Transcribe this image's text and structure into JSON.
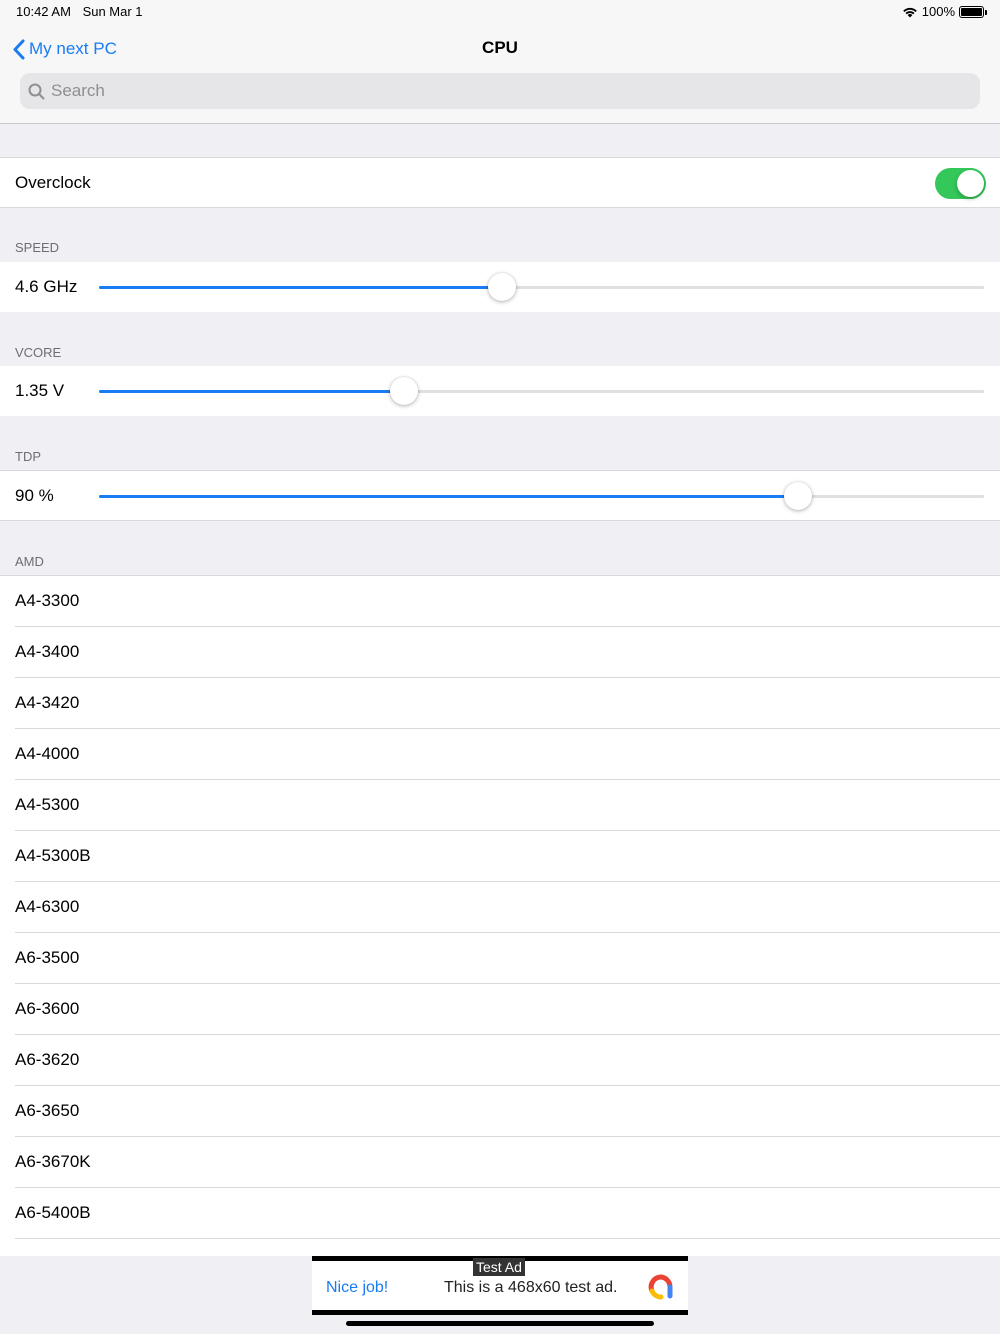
{
  "status_bar": {
    "time": "10:42 AM",
    "date": "Sun Mar 1",
    "battery": "100%"
  },
  "nav": {
    "back_label": "My next PC",
    "title": "CPU"
  },
  "search": {
    "placeholder": "Search",
    "value": ""
  },
  "overclock": {
    "label": "Overclock",
    "on": true
  },
  "sliders": [
    {
      "header": "SPEED",
      "value_label": "4.6 GHz",
      "fraction": 0.455
    },
    {
      "header": "VCORE",
      "value_label": "1.35 V",
      "fraction": 0.345
    },
    {
      "header": "TDP",
      "value_label": "90 %",
      "fraction": 0.79
    }
  ],
  "list": {
    "header": "AMD",
    "items": [
      "A4-3300",
      "A4-3400",
      "A4-3420",
      "A4-4000",
      "A4-5300",
      "A4-5300B",
      "A4-6300",
      "A6-3500",
      "A6-3600",
      "A6-3620",
      "A6-3650",
      "A6-3670K",
      "A6-5400B"
    ]
  },
  "ad": {
    "label": "Test Ad",
    "headline": "Nice job!",
    "body": "This is a 468x60 test ad."
  },
  "colors": {
    "accent": "#1a7cf2",
    "toggle_on": "#34c759",
    "background": "#efeff4"
  }
}
